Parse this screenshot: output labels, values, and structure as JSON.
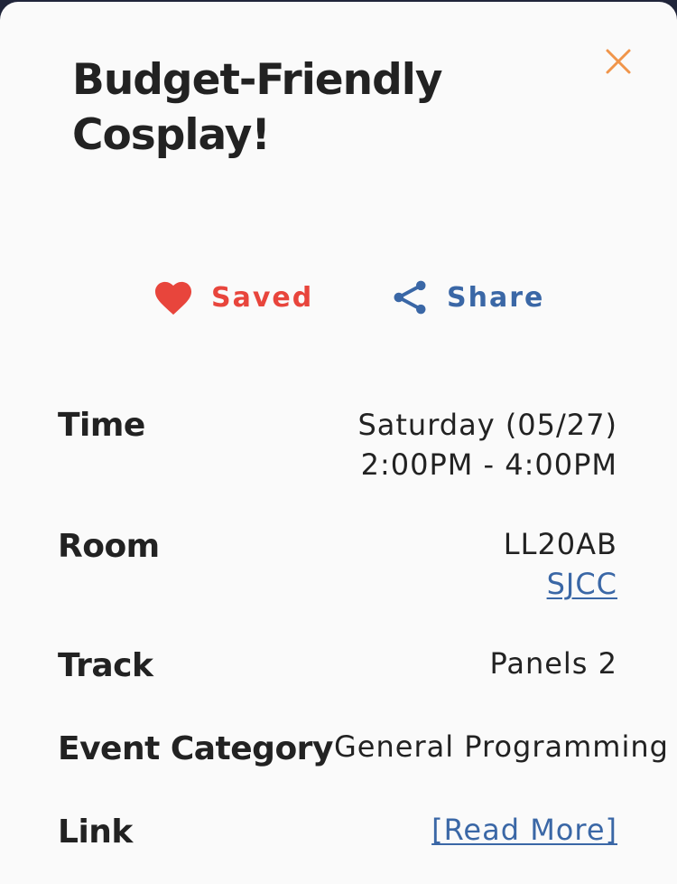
{
  "event": {
    "title": "Budget-Friendly Cosplay!"
  },
  "actions": {
    "saved_label": "Saved",
    "share_label": "Share"
  },
  "details": {
    "time_label": "Time",
    "time_day": "Saturday (05/27)",
    "time_range": "2:00PM - 4:00PM",
    "room_label": "Room",
    "room_value": "LL20AB",
    "room_link": "SJCC",
    "track_label": "Track",
    "track_value": "Panels 2",
    "category_label": "Event Category",
    "category_value": "General Programming",
    "link_label": "Link",
    "link_value": "[Read More]"
  },
  "colors": {
    "saved": "#e8453c",
    "share": "#3a67a6",
    "close": "#f0954a",
    "link": "#3a67a6"
  },
  "icons": {
    "close": "close-icon",
    "saved": "heart-icon",
    "share": "share-icon"
  }
}
